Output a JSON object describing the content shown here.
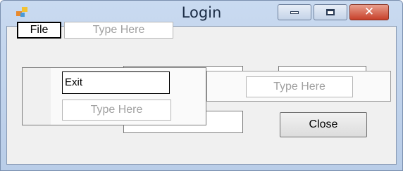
{
  "window": {
    "title": "Login"
  },
  "menu": {
    "file_label": "File",
    "type_here_placeholder": "Type Here"
  },
  "dropdown": {
    "exit_label": "Exit",
    "type_here_placeholder": "Type Here"
  },
  "submenu": {
    "type_here_placeholder": "Type Here"
  },
  "buttons": {
    "close_label": "Close"
  },
  "icons": {
    "app": "app-icon",
    "minimize": "minimize-icon",
    "maximize": "maximize-icon",
    "close": "close-icon"
  }
}
